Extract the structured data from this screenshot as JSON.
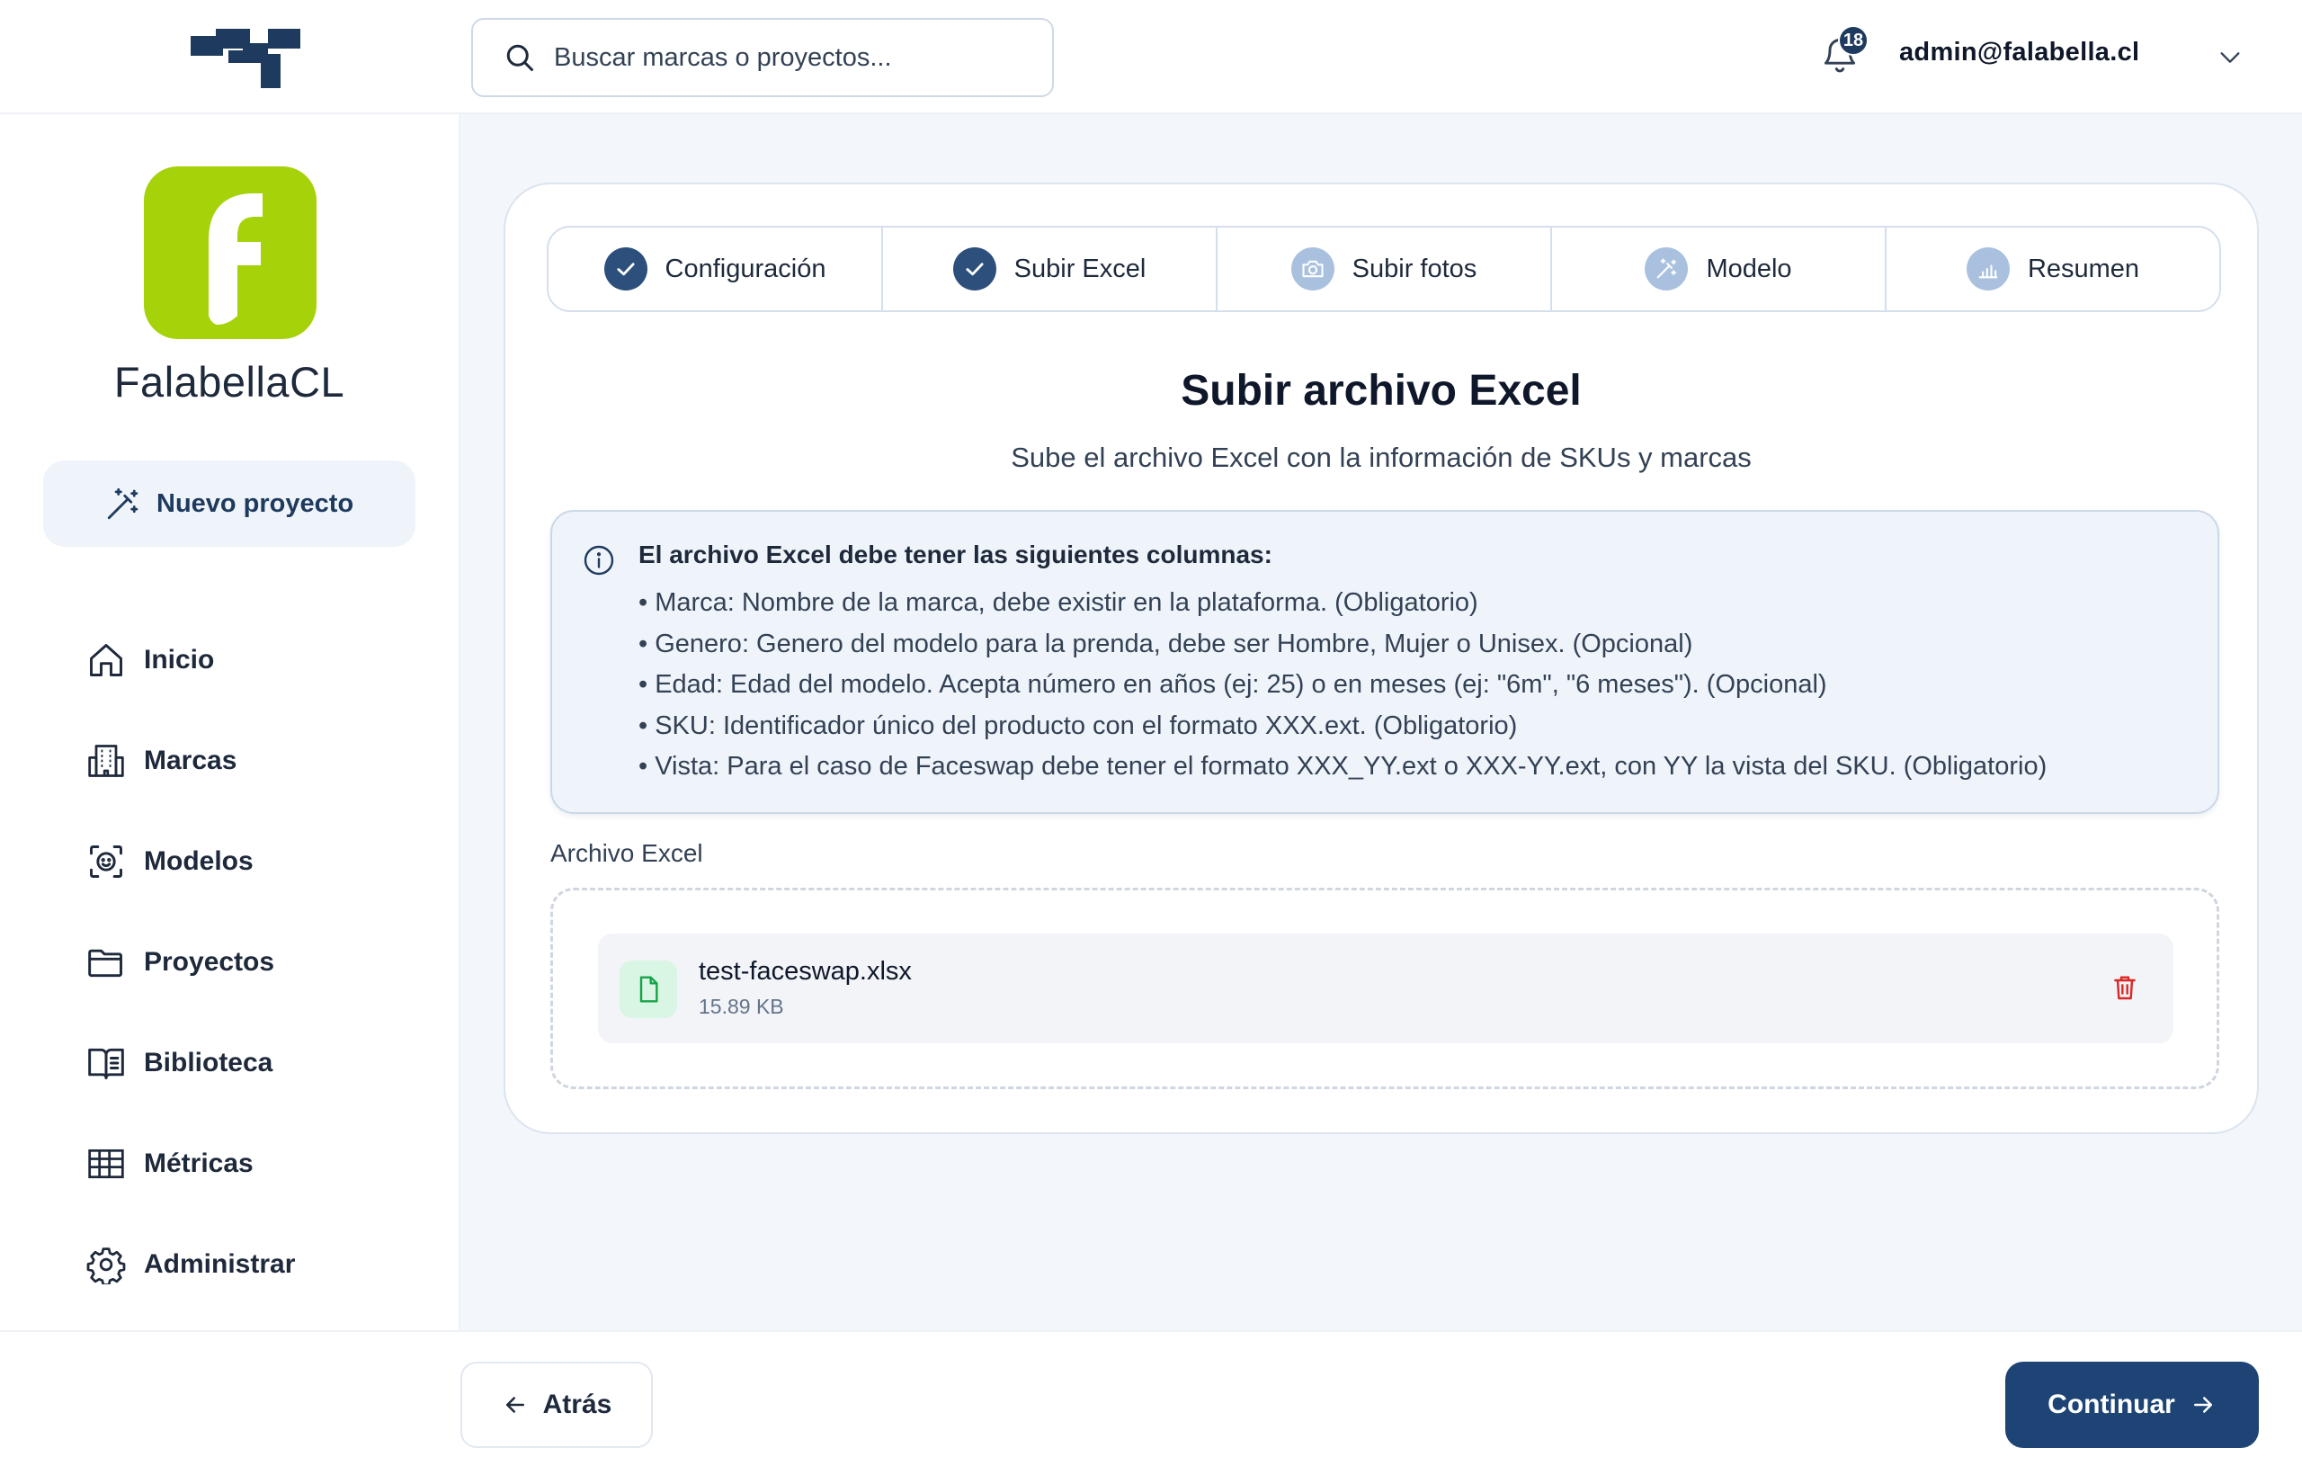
{
  "header": {
    "search_placeholder": "Buscar marcas o proyectos...",
    "notification_count": "18",
    "user_email": "admin@falabella.cl"
  },
  "sidebar": {
    "brand_name": "FalabellaCL",
    "new_project_label": "Nuevo proyecto",
    "items": [
      {
        "label": "Inicio",
        "icon": "home-icon"
      },
      {
        "label": "Marcas",
        "icon": "building-icon"
      },
      {
        "label": "Modelos",
        "icon": "face-scan-icon"
      },
      {
        "label": "Proyectos",
        "icon": "folder-icon"
      },
      {
        "label": "Biblioteca",
        "icon": "book-icon"
      },
      {
        "label": "Métricas",
        "icon": "table-icon"
      },
      {
        "label": "Administrar",
        "icon": "gear-icon"
      }
    ]
  },
  "steps": [
    {
      "label": "Configuración",
      "state": "done",
      "icon": "check-icon"
    },
    {
      "label": "Subir Excel",
      "state": "done",
      "icon": "check-icon"
    },
    {
      "label": "Subir fotos",
      "state": "pending",
      "icon": "camera-icon"
    },
    {
      "label": "Modelo",
      "state": "pending",
      "icon": "magic-wand-icon"
    },
    {
      "label": "Resumen",
      "state": "pending",
      "icon": "chart-icon"
    }
  ],
  "main": {
    "title": "Subir archivo Excel",
    "subtitle": "Sube el archivo Excel con la información de SKUs y marcas",
    "info": {
      "title": "El archivo Excel debe tener las siguientes columnas:",
      "lines": [
        "• Marca: Nombre de la marca, debe existir en la plataforma. (Obligatorio)",
        "• Genero: Genero del modelo para la prenda, debe ser Hombre, Mujer o Unisex. (Opcional)",
        "• Edad: Edad del modelo. Acepta número en años (ej: 25) o en meses (ej: \"6m\", \"6 meses\"). (Opcional)",
        "• SKU: Identificador único del producto con el formato XXX.ext. (Obligatorio)",
        "• Vista: Para el caso de Faceswap debe tener el formato XXX_YY.ext o XXX-YY.ext, con YY la vista del SKU. (Obligatorio)"
      ]
    },
    "file_label": "Archivo Excel",
    "file": {
      "name": "test-faceswap.xlsx",
      "size": "15.89 KB"
    }
  },
  "footer": {
    "back_label": "Atrás",
    "continue_label": "Continuar"
  },
  "colors": {
    "primary": "#1e4475",
    "brand_green": "#a6d20a",
    "step_done": "#2c4f7c",
    "step_pending": "#a9c1df",
    "danger": "#dc2626",
    "success_bg": "#d9f5e3"
  }
}
